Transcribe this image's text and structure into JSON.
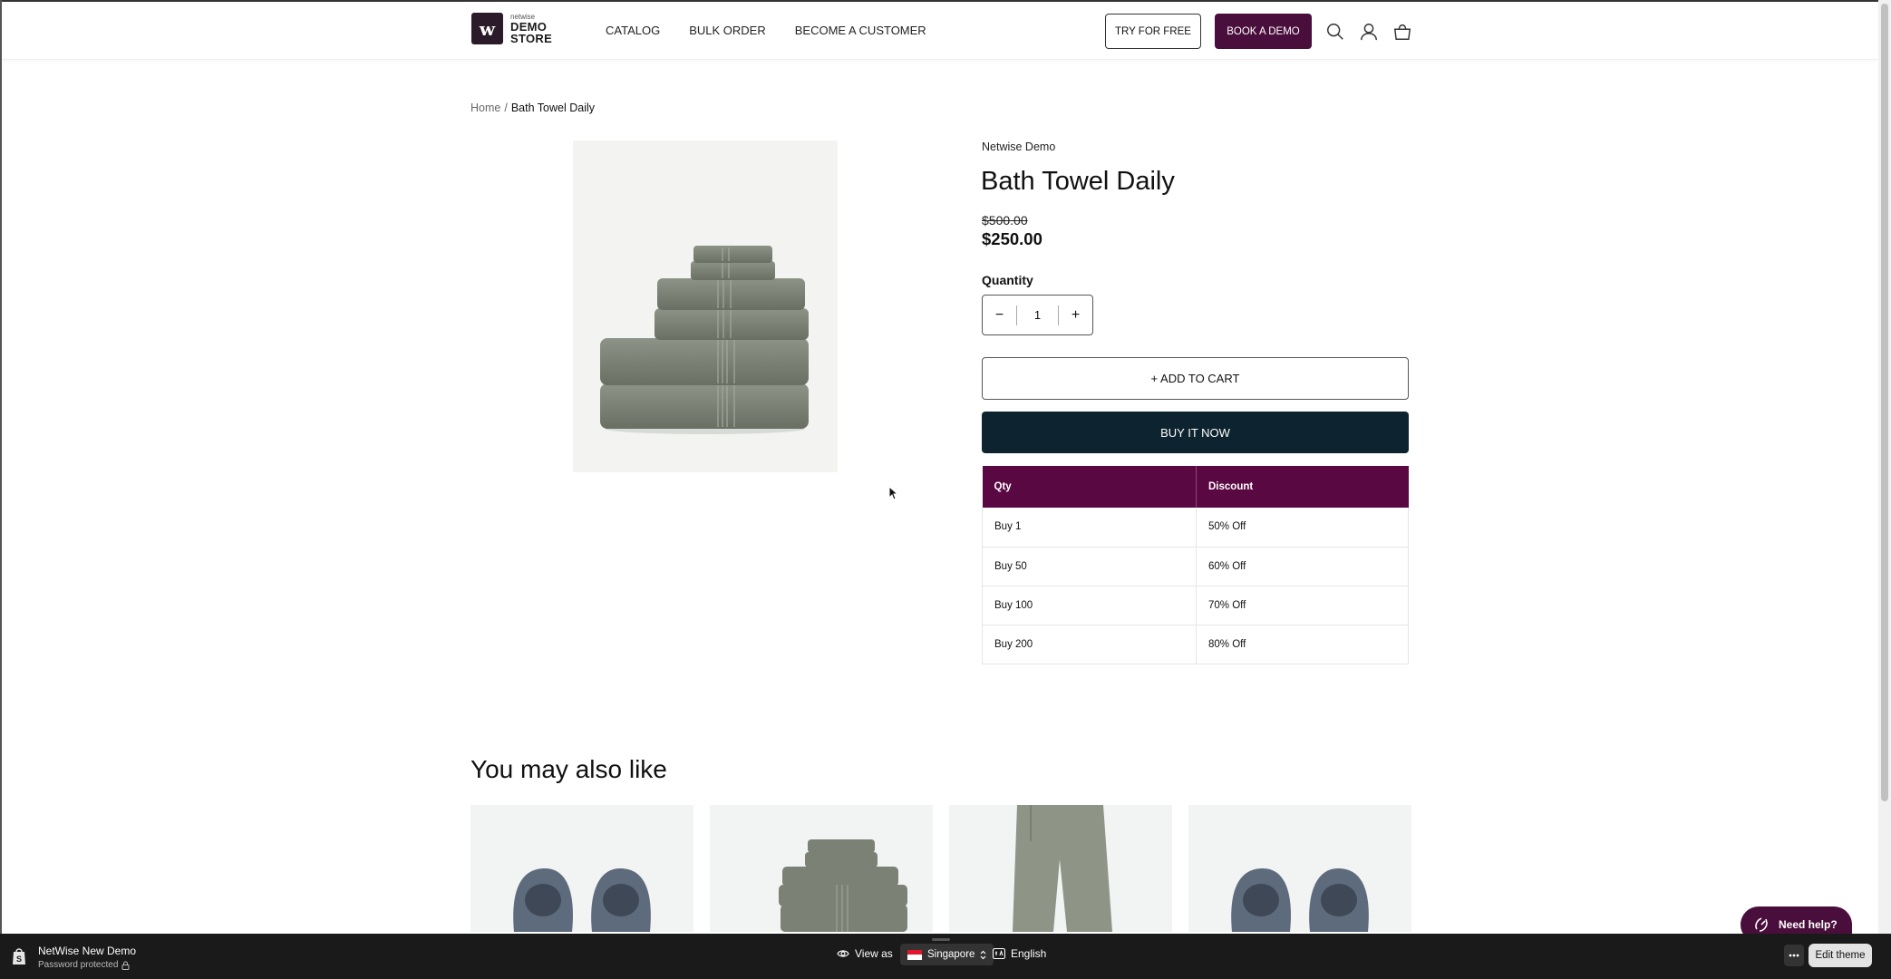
{
  "header": {
    "logo_small": "netwise",
    "logo_line1": "DEMO",
    "logo_line2": "STORE",
    "nav": [
      "CATALOG",
      "BULK ORDER",
      "BECOME A CUSTOMER"
    ],
    "try_button": "TRY FOR FREE",
    "demo_button": "BOOK A DEMO",
    "icons": [
      "search-icon",
      "account-icon",
      "cart-icon"
    ]
  },
  "breadcrumb": {
    "home": "Home",
    "separator": "/",
    "current": "Bath Towel Daily"
  },
  "product": {
    "vendor": "Netwise Demo",
    "title": "Bath Towel Daily",
    "compare_price": "$500.00",
    "price": "$250.00",
    "quantity_label": "Quantity",
    "quantity_value": "1",
    "decrement": "−",
    "increment": "+",
    "add_to_cart": "+ ADD TO CART",
    "buy_now": "BUY IT NOW"
  },
  "discount_table": {
    "headers": [
      "Qty",
      "Discount"
    ],
    "rows": [
      [
        "Buy 1",
        "50% Off"
      ],
      [
        "Buy 50",
        "60% Off"
      ],
      [
        "Buy 100",
        "70% Off"
      ],
      [
        "Buy 200",
        "80% Off"
      ]
    ]
  },
  "related": {
    "title": "You may also like"
  },
  "help_button": "Need help?",
  "bottom_bar": {
    "store_name": "NetWise New Demo",
    "status": "Password protected",
    "view_as": "View as",
    "country": "Singapore",
    "language": "English",
    "edit_theme": "Edit theme"
  },
  "colors": {
    "brand": "#4a0e3c",
    "table_header": "#5a0842",
    "buy_now": "#0d2430",
    "bottom_bar": "#1a1a1a"
  }
}
